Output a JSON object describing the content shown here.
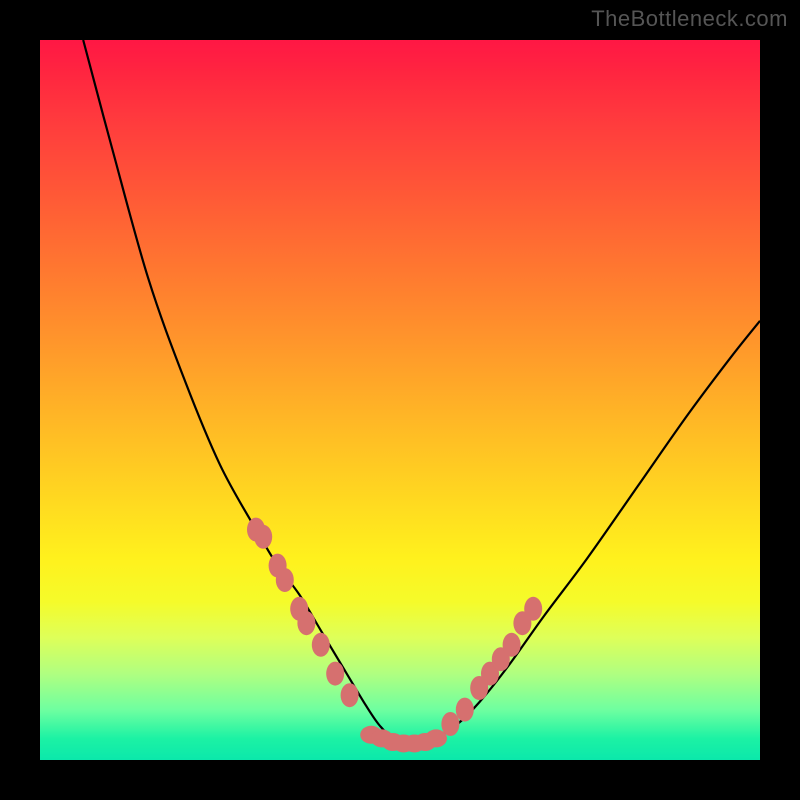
{
  "watermark": "TheBottleneck.com",
  "colors": {
    "frame": "#000000",
    "curve": "#000000",
    "beads": "#d6706f",
    "gradient_top": "#ff1744",
    "gradient_bottom": "#0be8ab"
  },
  "chart_data": {
    "type": "line",
    "title": "",
    "xlabel": "",
    "ylabel": "",
    "xlim": [
      0,
      100
    ],
    "ylim": [
      0,
      100
    ],
    "grid": false,
    "legend": false,
    "annotations": [
      "TheBottleneck.com"
    ],
    "series": [
      {
        "name": "bottleneck-curve",
        "x": [
          6,
          10,
          15,
          20,
          25,
          30,
          33,
          36,
          39,
          42,
          45,
          47,
          49,
          51,
          53,
          55,
          58,
          61,
          65,
          70,
          76,
          83,
          90,
          96,
          100
        ],
        "values": [
          100,
          85,
          67,
          53,
          41,
          32,
          27,
          23,
          18,
          13,
          8,
          5,
          3,
          2,
          2,
          3,
          5,
          8,
          13,
          20,
          28,
          38,
          48,
          56,
          61
        ]
      }
    ],
    "markers": {
      "name": "highlighted-points",
      "left_arm": [
        [
          30,
          32
        ],
        [
          31,
          31
        ],
        [
          33,
          27
        ],
        [
          34,
          25
        ],
        [
          36,
          21
        ],
        [
          37,
          19
        ],
        [
          39,
          16
        ],
        [
          41,
          12
        ],
        [
          43,
          9
        ]
      ],
      "flat": [
        [
          46,
          3.5
        ],
        [
          47.5,
          3
        ],
        [
          49,
          2.5
        ],
        [
          50.5,
          2.3
        ],
        [
          52,
          2.3
        ],
        [
          53.5,
          2.5
        ],
        [
          55,
          3
        ]
      ],
      "right_arm": [
        [
          57,
          5
        ],
        [
          59,
          7
        ],
        [
          61,
          10
        ],
        [
          62.5,
          12
        ],
        [
          64,
          14
        ],
        [
          65.5,
          16
        ],
        [
          67,
          19
        ],
        [
          68.5,
          21
        ]
      ]
    }
  }
}
